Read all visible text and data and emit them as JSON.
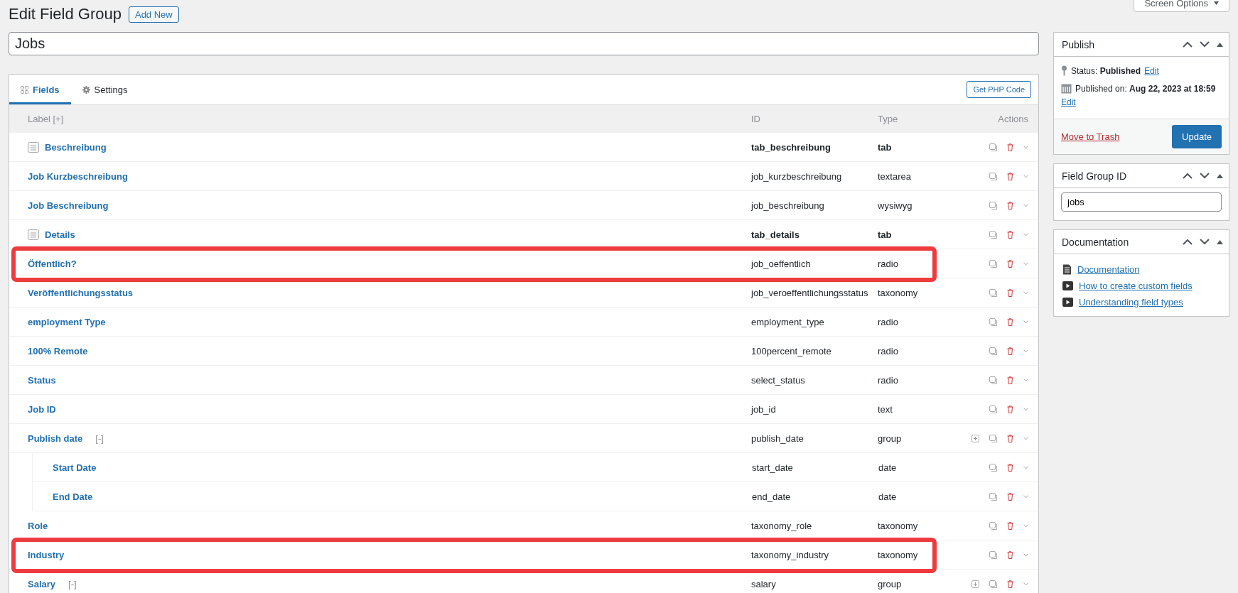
{
  "page": {
    "title": "Edit Field Group",
    "add_new": "Add New",
    "screen_options": "Screen Options"
  },
  "title_field": {
    "value": "Jobs"
  },
  "tabs": [
    {
      "label": "Fields",
      "selected": true
    },
    {
      "label": "Settings",
      "selected": false
    }
  ],
  "php_button": "Get PHP Code",
  "table": {
    "columns": [
      "Label [+]",
      "ID",
      "Type",
      "Actions"
    ],
    "rows": [
      {
        "kind": "tab",
        "label": "Beschreibung",
        "id": "tab_beschreibung",
        "type": "tab",
        "highlighted": false
      },
      {
        "kind": "field",
        "label": "Job Kurzbeschreibung",
        "id": "job_kurzbeschreibung",
        "type": "textarea",
        "highlighted": false
      },
      {
        "kind": "field",
        "label": "Job Beschreibung",
        "id": "job_beschreibung",
        "type": "wysiwyg",
        "highlighted": false
      },
      {
        "kind": "tab",
        "label": "Details",
        "id": "tab_details",
        "type": "tab",
        "highlighted": false
      },
      {
        "kind": "field",
        "label": "Öffentlich?",
        "id": "job_oeffentlich",
        "type": "radio",
        "highlighted": true
      },
      {
        "kind": "field",
        "label": "Veröffentlichungsstatus",
        "id": "job_veroeffentlichungsstatus",
        "type": "taxonomy",
        "highlighted": false
      },
      {
        "kind": "field",
        "label": "employment Type",
        "id": "employment_type",
        "type": "radio",
        "highlighted": false
      },
      {
        "kind": "field",
        "label": "100% Remote",
        "id": "100percent_remote",
        "type": "radio",
        "highlighted": false
      },
      {
        "kind": "field",
        "label": "Status",
        "id": "select_status",
        "type": "radio",
        "highlighted": false
      },
      {
        "kind": "field",
        "label": "Job ID",
        "id": "job_id",
        "type": "text",
        "highlighted": false
      },
      {
        "kind": "group",
        "label": "Publish date",
        "toggle": "[-]",
        "id": "publish_date",
        "type": "group",
        "highlighted": false,
        "children": [
          {
            "kind": "field",
            "label": "Start Date",
            "id": "start_date",
            "type": "date",
            "highlighted": false
          },
          {
            "kind": "field",
            "label": "End Date",
            "id": "end_date",
            "type": "date",
            "highlighted": false
          }
        ]
      },
      {
        "kind": "field",
        "label": "Role",
        "id": "taxonomy_role",
        "type": "taxonomy",
        "highlighted": false
      },
      {
        "kind": "field",
        "label": "Industry",
        "id": "taxonomy_industry",
        "type": "taxonomy",
        "highlighted": true
      },
      {
        "kind": "group",
        "label": "Salary",
        "toggle": "[-]",
        "id": "salary",
        "type": "group",
        "highlighted": false
      }
    ]
  },
  "publish": {
    "title": "Publish",
    "status_label": "Status:",
    "status": "Published",
    "status_edit": "Edit",
    "date_label": "Published on:",
    "date": "Aug 22, 2023 at 18:59",
    "date_edit": "Edit",
    "trash": "Move to Trash",
    "update": "Update"
  },
  "field_group_id": {
    "title": "Field Group ID",
    "value": "jobs"
  },
  "documentation": {
    "title": "Documentation",
    "links": [
      {
        "label": "Documentation"
      },
      {
        "label": "How to create custom fields"
      },
      {
        "label": "Understanding field types"
      }
    ]
  }
}
